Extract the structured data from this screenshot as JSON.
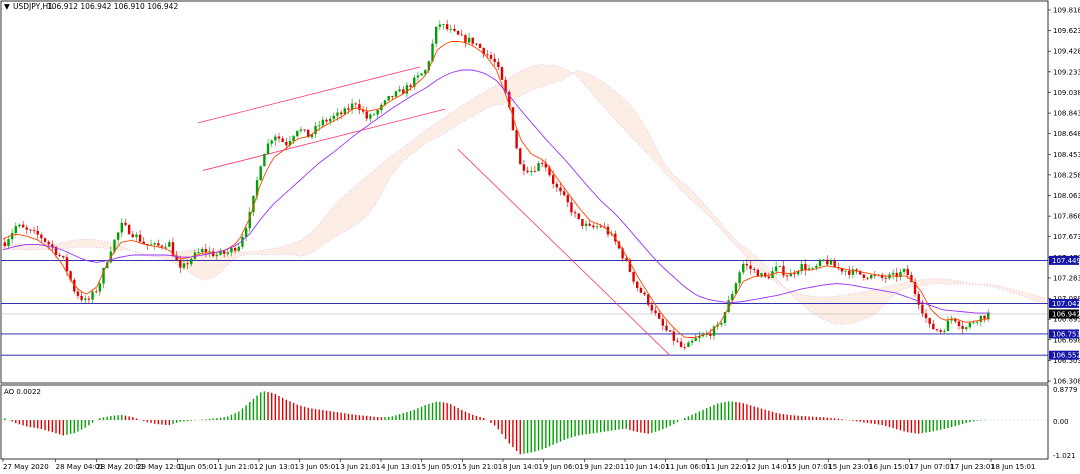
{
  "header": {
    "symbol": "USDJPY,H1",
    "ohlc": "106.912 106.942 106.910 106.942"
  },
  "indicator": {
    "label": "AO 0.0022",
    "scale_top": "0.8779",
    "scale_zero": "0.00",
    "scale_bottom": "-1.021"
  },
  "colors": {
    "bull_candle": "#00a000",
    "bear_candle": "#e00000",
    "ma_fast": "#ff4400",
    "ma_slow": "#9933ff",
    "cloud_a": "#f5a070",
    "cloud_b": "#d8a8e0",
    "hline": "#1515a8",
    "channel": "#ff3377",
    "ao_up": "#00a000",
    "ao_down": "#e00000",
    "price_tag": "#1515a8",
    "current_tag": "#000000"
  },
  "chart_data": {
    "type": "candlestick",
    "symbol": "USDJPY",
    "timeframe": "H1",
    "ylim": [
      106.308,
      109.818
    ],
    "y_ticks": [
      "109.818",
      "109.623",
      "109.428",
      "109.233",
      "109.038",
      "108.843",
      "108.648",
      "108.453",
      "108.258",
      "108.063",
      "107.868",
      "107.673",
      "107.478",
      "107.283",
      "107.088",
      "106.893",
      "106.698",
      "106.503",
      "106.308"
    ],
    "x_ticks": [
      "27 May 2020",
      "28 May 04:01",
      "28 May 20:01",
      "29 May 12:01",
      "1 Jun 05:01",
      "1 Jun 21:01",
      "2 Jun 13:01",
      "3 Jun 05:01",
      "3 Jun 21:01",
      "4 Jun 13:01",
      "5 Jun 05:01",
      "5 Jun 21:01",
      "8 Jun 14:01",
      "9 Jun 06:01",
      "9 Jun 22:01",
      "10 Jun 14:01",
      "11 Jun 06:01",
      "11 Jun 22:01",
      "12 Jun 14:01",
      "15 Jun 07:01",
      "15 Jun 23:01",
      "16 Jun 15:01",
      "17 Jun 07:01",
      "17 Jun 23:01",
      "18 Jun 15:01"
    ],
    "close_path": [
      107.62,
      107.78,
      107.72,
      107.68,
      107.58,
      107.45,
      107.15,
      107.05,
      107.2,
      107.55,
      107.78,
      107.7,
      107.6,
      107.58,
      107.62,
      107.35,
      107.48,
      107.55,
      107.5,
      107.52,
      107.6,
      107.9,
      108.45,
      108.65,
      108.55,
      108.7,
      108.62,
      108.75,
      108.8,
      108.85,
      108.95,
      108.78,
      108.88,
      109.0,
      109.05,
      109.15,
      109.25,
      109.7,
      109.62,
      109.55,
      109.52,
      109.42,
      109.3,
      108.95,
      108.35,
      108.3,
      108.4,
      108.15,
      108.0,
      107.82,
      107.75,
      107.78,
      107.65,
      107.45,
      107.2,
      107.05,
      106.85,
      106.72,
      106.6,
      106.7,
      106.75,
      106.82,
      107.1,
      107.42,
      107.35,
      107.28,
      107.38,
      107.3,
      107.4,
      107.35,
      107.45,
      107.38,
      107.35,
      107.32,
      107.3,
      107.28,
      107.3,
      107.35,
      107.08,
      106.82,
      106.78,
      106.92,
      106.8,
      106.9,
      106.94
    ],
    "ma_fast_path": [
      107.65,
      107.7,
      107.68,
      107.64,
      107.56,
      107.42,
      107.22,
      107.12,
      107.2,
      107.45,
      107.62,
      107.64,
      107.6,
      107.58,
      107.56,
      107.46,
      107.48,
      107.52,
      107.52,
      107.55,
      107.62,
      107.85,
      108.2,
      108.42,
      108.5,
      108.6,
      108.62,
      108.7,
      108.76,
      108.82,
      108.9,
      108.86,
      108.88,
      108.96,
      109.02,
      109.1,
      109.2,
      109.45,
      109.52,
      109.52,
      109.48,
      109.4,
      109.25,
      108.95,
      108.6,
      108.45,
      108.4,
      108.25,
      108.1,
      107.95,
      107.82,
      107.78,
      107.68,
      107.5,
      107.3,
      107.12,
      106.95,
      106.82,
      106.72,
      106.72,
      106.76,
      106.85,
      107.05,
      107.25,
      107.3,
      107.3,
      107.34,
      107.32,
      107.36,
      107.36,
      107.4,
      107.38,
      107.36,
      107.34,
      107.32,
      107.3,
      107.3,
      107.3,
      107.18,
      106.98,
      106.88,
      106.9,
      106.86,
      106.88,
      106.9
    ],
    "ma_slow_path": [
      107.55,
      107.58,
      107.6,
      107.6,
      107.58,
      107.55,
      107.5,
      107.45,
      107.43,
      107.45,
      107.48,
      107.5,
      107.5,
      107.5,
      107.5,
      107.48,
      107.48,
      107.5,
      107.52,
      107.55,
      107.6,
      107.7,
      107.85,
      107.98,
      108.08,
      108.18,
      108.28,
      108.38,
      108.46,
      108.55,
      108.64,
      108.72,
      108.8,
      108.88,
      108.95,
      109.02,
      109.08,
      109.16,
      109.22,
      109.25,
      109.25,
      109.22,
      109.15,
      109.02,
      108.88,
      108.75,
      108.62,
      108.5,
      108.38,
      108.25,
      108.12,
      108.0,
      107.9,
      107.78,
      107.65,
      107.52,
      107.4,
      107.3,
      107.2,
      107.12,
      107.08,
      107.06,
      107.05,
      107.06,
      107.08,
      107.1,
      107.12,
      107.15,
      107.18,
      107.2,
      107.22,
      107.23,
      107.22,
      107.2,
      107.18,
      107.16,
      107.14,
      107.1,
      107.06,
      107.02,
      106.98,
      106.97,
      106.96,
      106.95,
      106.95
    ],
    "horizontal_levels": [
      107.449,
      107.042,
      106.753,
      106.552
    ],
    "level_labels": [
      "107.449",
      "107.042",
      "106.753",
      "106.552"
    ],
    "current_price": 106.942,
    "current_price_label": "106.942",
    "ao_path": [
      0.05,
      -0.1,
      -0.2,
      -0.25,
      -0.35,
      -0.45,
      -0.38,
      -0.2,
      0.05,
      0.12,
      0.15,
      0.08,
      -0.05,
      -0.12,
      -0.15,
      -0.05,
      -0.02,
      0.02,
      0.05,
      0.1,
      0.25,
      0.55,
      0.85,
      0.78,
      0.6,
      0.45,
      0.35,
      0.3,
      0.25,
      0.2,
      0.15,
      0.12,
      0.08,
      0.1,
      0.2,
      0.3,
      0.45,
      0.55,
      0.48,
      0.3,
      0.15,
      0.05,
      -0.2,
      -0.65,
      -1.0,
      -0.95,
      -0.85,
      -0.7,
      -0.55,
      -0.45,
      -0.4,
      -0.35,
      -0.3,
      -0.25,
      -0.35,
      -0.4,
      -0.3,
      -0.15,
      0.05,
      0.2,
      0.35,
      0.5,
      0.55,
      0.5,
      0.4,
      0.3,
      0.2,
      0.15,
      0.12,
      0.1,
      0.08,
      0.05,
      0.0,
      -0.05,
      -0.1,
      -0.15,
      -0.25,
      -0.35,
      -0.4,
      -0.35,
      -0.28,
      -0.2,
      -0.1,
      -0.02,
      0.0
    ],
    "ao_ylim": [
      -1.021,
      0.8779
    ]
  }
}
